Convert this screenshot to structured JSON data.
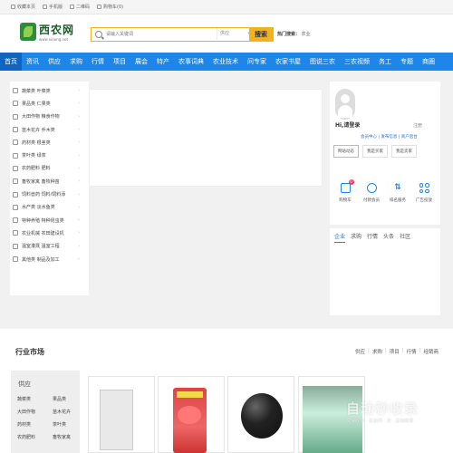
{
  "topbar": {
    "links": [
      {
        "label": "收藏本页",
        "icon": "star-icon"
      },
      {
        "label": "手机版",
        "icon": "phone-icon"
      },
      {
        "label": "二维码",
        "icon": "qrcode-icon"
      },
      {
        "label": "购物车(0)",
        "icon": "cart-icon"
      }
    ]
  },
  "header": {
    "logo_name": "西农网",
    "logo_url": "www.xinong.net",
    "search": {
      "placeholder": "请输入关键词",
      "category": "供应",
      "button": "搜索"
    },
    "hot_label": "热门搜索：",
    "hot_item": "农业"
  },
  "nav": {
    "items": [
      "首页",
      "资讯",
      "供应",
      "求购",
      "行情",
      "项目",
      "展会",
      "特产",
      "农事词典",
      "农业技术",
      "问专家",
      "农家书屋",
      "图说三农",
      "三农视频",
      "务工",
      "专题",
      "商圈"
    ]
  },
  "categories": [
    "蔬菜类 叶菜类",
    "果品类 仁果类",
    "大田作物 粮食作物",
    "苗木花卉 乔木类",
    "药材类 根茎类",
    "茶叶类 绿茶",
    "农药肥料 肥料",
    "畜牧家禽 畜牧种苗",
    "饲料兽药 饲料/饲料添",
    "水产类 淡水鱼类",
    "特种养殖 特种昆虫类",
    "农业机械 农田建设机",
    "温室灌溉 温室工程",
    "其他类 制品及加工"
  ],
  "user": {
    "greeting": "Hi,请登录",
    "exit": "注册",
    "links": "会员中心 | 发布信息 | 商户后台",
    "tabs": [
      "网站动态",
      "我是买家",
      "我是卖家"
    ],
    "icons": [
      {
        "label": "购物车",
        "icon": "cart-icon"
      },
      {
        "label": "付款会员",
        "icon": "pay-icon"
      },
      {
        "label": "排名服务",
        "icon": "sort-icon"
      },
      {
        "label": "广告投放",
        "icon": "grid-icon"
      }
    ]
  },
  "news": {
    "tabs": [
      "企业",
      "求购",
      "行情",
      "头条",
      "社区"
    ]
  },
  "market": {
    "title": "行业市场",
    "tabs": [
      "供应",
      "求购",
      "项目",
      "行情",
      "经销商"
    ],
    "side_title": "供应",
    "side_items": [
      "蔬菜类",
      "果品类",
      "大田作物",
      "苗木花卉",
      "药材类",
      "茶叶类",
      "农药肥料",
      "畜牧家禽"
    ]
  },
  "watermark": {
    "title": "自动秒收录",
    "subtitle": "快速收录 · 长访问 · 次 · 自动收录 ·"
  }
}
